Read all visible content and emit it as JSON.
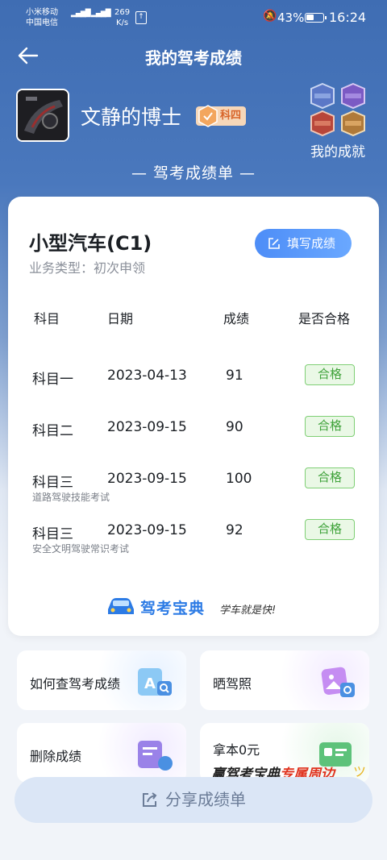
{
  "status_bar": {
    "carrier_1": "小米移动",
    "carrier_2": "中国电信",
    "net_speed_value": "269",
    "net_speed_unit": "K/s",
    "battery": "43%",
    "time": "16:24"
  },
  "header": {
    "title": "我的驾考成绩"
  },
  "profile": {
    "username": "文静的博士",
    "level_badge": "科四",
    "achievements_label": "我的成就"
  },
  "report_title": "— 驾考成绩单 —",
  "card": {
    "vehicle_type": "小型汽车(C1)",
    "business_type": "业务类型：初次申领",
    "fill_button": "填写成绩",
    "columns": [
      "科目",
      "日期",
      "成绩",
      "是否合格"
    ],
    "rows": [
      {
        "subject": "科目一",
        "date": "2023-04-13",
        "score": "91",
        "result": "合格",
        "note": ""
      },
      {
        "subject": "科目二",
        "date": "2023-09-15",
        "score": "90",
        "result": "合格",
        "note": ""
      },
      {
        "subject": "科目三",
        "date": "2023-09-15",
        "score": "100",
        "result": "合格",
        "note": "道路驾驶技能考试"
      },
      {
        "subject": "科目三",
        "date": "2023-09-15",
        "score": "92",
        "result": "合格",
        "note": "安全文明驾驶常识考试"
      }
    ],
    "brand_name": "驾考宝典",
    "brand_slogan": "学车就是快!"
  },
  "tiles": {
    "how_to_check": "如何查驾考成绩",
    "show_license": "晒驾照",
    "delete_scores": "删除成绩",
    "license_promo": "拿本0元"
  },
  "banner": {
    "text_main": "赢驾考宝典",
    "text_highlight": "专属周边"
  },
  "share_button": "分享成绩单",
  "colors": {
    "header_blue": "#3f6db3",
    "accent_blue": "#4d8df7",
    "pass_green": "#3fa23a",
    "pass_bg": "#eaf8e6",
    "badge_orange": "#d8652a"
  },
  "icons": [
    "back-arrow-icon",
    "edit-icon",
    "share-icon",
    "mute-icon",
    "battery-icon",
    "upload-icon"
  ]
}
